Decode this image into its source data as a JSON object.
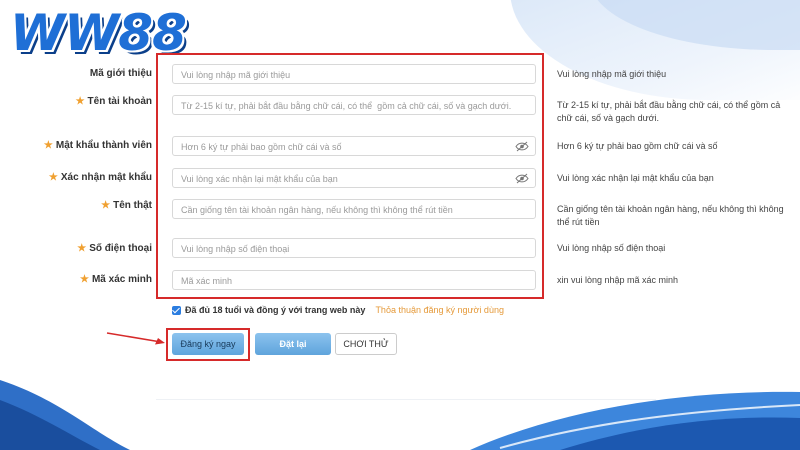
{
  "brand": {
    "logo_text": "WW88",
    "primary": "#1f6fd6",
    "accent_red": "#d62a2a"
  },
  "form": {
    "rows": [
      {
        "label": "Mã giới thiệu",
        "required": false,
        "placeholder": "Vui lòng nhập mã giới thiệu",
        "hint": "Vui lòng nhập mã giới thiệu",
        "password": false
      },
      {
        "label": "Tên tài khoản",
        "required": true,
        "placeholder": "Từ 2-15 kí tự, phải bắt đầu bằng chữ cái, có thể  gồm cả chữ cái, số và gạch dưới.",
        "hint": "Từ 2-15 kí tự, phải bắt đầu bằng chữ cái, có thể gồm cả chữ cái, số và gạch dưới.",
        "password": false
      },
      {
        "label": "Mật khẩu thành viên",
        "required": true,
        "placeholder": "Hơn 6 ký tự phải bao gồm chữ cái và số",
        "hint": "Hơn 6 ký tự phải bao gồm chữ cái và số",
        "password": true
      },
      {
        "label": "Xác nhận mật khẩu",
        "required": true,
        "placeholder": "Vui lòng xác nhận lại mật khẩu của bạn",
        "hint": "Vui lòng xác nhận lại mật khẩu của bạn",
        "password": true
      },
      {
        "label": "Tên thật",
        "required": true,
        "placeholder": "Cần giống tên tài khoản ngân hàng, nếu không thì không thể rút tiền",
        "hint": "Cần giống tên tài khoản ngân hàng, nếu không thì không thể rút tiền",
        "password": false
      },
      {
        "label": "Số điện thoại",
        "required": true,
        "placeholder": "Vui lòng nhập số điện thoại",
        "hint": "Vui lòng nhập số điện thoại",
        "password": false
      },
      {
        "label": "Mã xác minh",
        "required": true,
        "placeholder": "Mã xác minh",
        "hint": "xin vui lòng nhập mã xác minh",
        "password": false
      }
    ],
    "agree_text": "Đã đủ 18 tuổi và đồng ý với trang web này",
    "agree_link": "Thỏa thuận đăng ký người dùng",
    "agree_checked": true,
    "buttons": {
      "register": "Đăng ký ngay",
      "reset": "Đặt lại",
      "try": "CHƠI THỬ"
    }
  }
}
